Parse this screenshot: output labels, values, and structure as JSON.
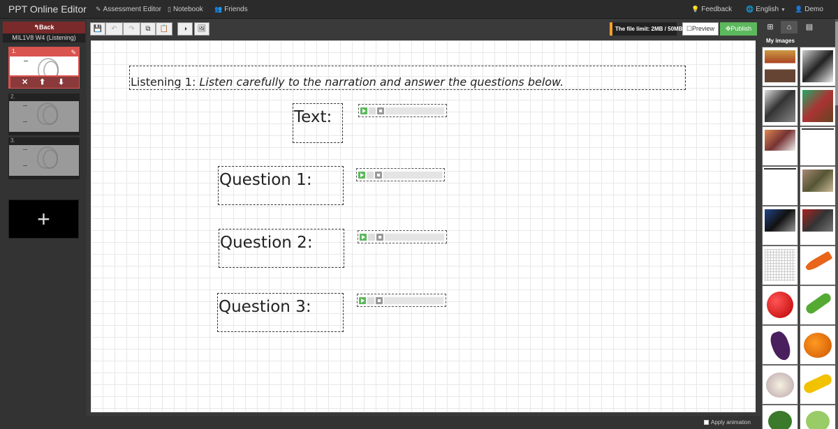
{
  "nav": {
    "brand": "PPT Online Editor",
    "assessment_editor": "Assessment Editor",
    "notebook": "Notebook",
    "friends": "Friends",
    "feedback": "Feedback",
    "language": "English",
    "user": "Demo"
  },
  "sidebar": {
    "back_label": "Back",
    "deck_name": "MIL1V8 W4 (Listening)",
    "slides": [
      {
        "number": "1."
      },
      {
        "number": "2."
      },
      {
        "number": "3."
      }
    ],
    "add_slide": "+"
  },
  "toolbar": {
    "file_limit": "The file limit: 2MB / 50MB",
    "preview": "Preview",
    "publish": "Publish"
  },
  "canvas": {
    "title_prefix": "Listening 1:",
    "title_instruction": "Listen carefully to the narration and answer the questions below.",
    "text_label": "Text:",
    "question1": "Question 1:",
    "question2": "Question 2:",
    "question3": "Question 3:"
  },
  "footer": {
    "apply_animation": "Apply animation"
  },
  "images_panel": {
    "label": "My images",
    "images": [
      "cook-with-jars",
      "chef-in-kitchen",
      "barber-cutting-hair",
      "woman-cooking-pan",
      "butcher-with-meat",
      "blank-strip",
      "blank-strip",
      "carpenter-woodworking",
      "mechanic-with-car",
      "worker-with-tools",
      "word-search-grid",
      "carrot",
      "tomato",
      "cucumber",
      "eggplant",
      "pumpkin",
      "cauliflower",
      "corn",
      "broccoli",
      "cabbage"
    ]
  },
  "colors": {
    "accent_red": "#d9534f",
    "publish_green": "#5cb85c",
    "file_limit_orange": "#f0a030"
  }
}
